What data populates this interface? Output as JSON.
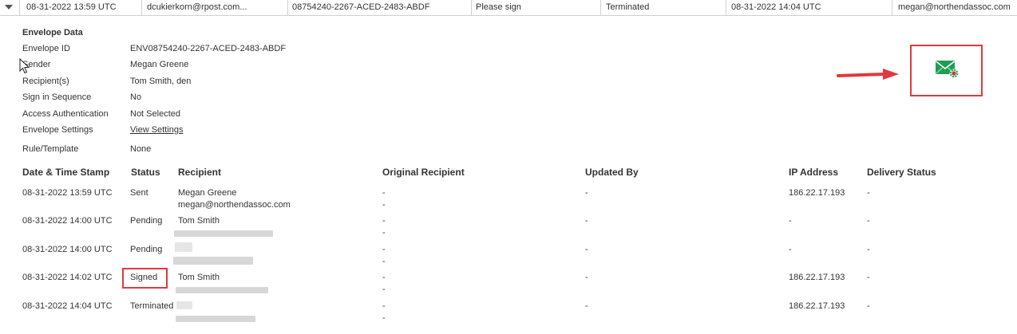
{
  "summary_row": {
    "cells": [
      "08-31-2022 13:59 UTC",
      "dcukierkorn@rpost.com...",
      "08754240-2267-ACED-2483-ABDF",
      "Please sign",
      "Terminated",
      "08-31-2022 14:04 UTC",
      "megan@northendassoc.com"
    ]
  },
  "envelope": {
    "title": "Envelope Data",
    "fields": [
      {
        "label": "Envelope ID",
        "value": "ENV08754240-2267-ACED-2483-ABDF"
      },
      {
        "label": "Sender",
        "value": "Megan Greene"
      },
      {
        "label": "Recipient(s)",
        "value": "Tom Smith, den"
      },
      {
        "label": "Sign in Sequence",
        "value": "No"
      },
      {
        "label": "Access Authentication",
        "value": "Not Selected"
      },
      {
        "label": "Envelope Settings",
        "value": "View Settings"
      },
      {
        "label": "Rule/Template",
        "value": "None"
      }
    ]
  },
  "history": {
    "headers": [
      "Date & Time Stamp",
      "Status",
      "Recipient",
      "Original Recipient",
      "Updated By",
      "IP Address",
      "Delivery Status"
    ],
    "rows": [
      {
        "ts": "08-31-2022 13:59 UTC",
        "status": "Sent",
        "recipient_name": "Megan Greene",
        "recipient_email": "megan@northendassoc.com",
        "orig1": "-",
        "orig2": "-",
        "updated": "-",
        "ip": "186.22.17.193",
        "delivery": "-"
      },
      {
        "ts": "08-31-2022 14:00 UTC",
        "status": "Pending",
        "recipient_name": "Tom Smith",
        "recipient_email": "",
        "orig1": "-",
        "orig2": "-",
        "updated": "-",
        "ip": "-",
        "delivery": "-"
      },
      {
        "ts": "08-31-2022 14:00 UTC",
        "status": "Pending",
        "recipient_name": "",
        "recipient_email": "",
        "orig1": "-",
        "orig2": "-",
        "updated": "-",
        "ip": "-",
        "delivery": "-"
      },
      {
        "ts": "08-31-2022 14:02 UTC",
        "status": "Signed",
        "recipient_name": "Tom Smith",
        "recipient_email": "",
        "orig1": "-",
        "orig2": "-",
        "updated": "-",
        "ip": "186.22.17.193",
        "delivery": "-"
      },
      {
        "ts": "08-31-2022 14:04 UTC",
        "status": "Terminated",
        "recipient_name": "",
        "recipient_email": "",
        "orig1": "-",
        "orig2": "-",
        "updated": "-",
        "ip": "186.22.17.193",
        "delivery": "-"
      }
    ]
  },
  "icons": {
    "expand": "chevron-down-icon",
    "envelope_settings": "envelope-gear-icon",
    "pointer": "mouse-cursor-icon",
    "annotation_arrow": "red-arrow-icon"
  },
  "colors": {
    "annotation_red": "#e0393e",
    "icon_green": "#1f9e53",
    "gear_red": "#d33a2c",
    "text": "#333333",
    "border": "#d0d0d0"
  }
}
